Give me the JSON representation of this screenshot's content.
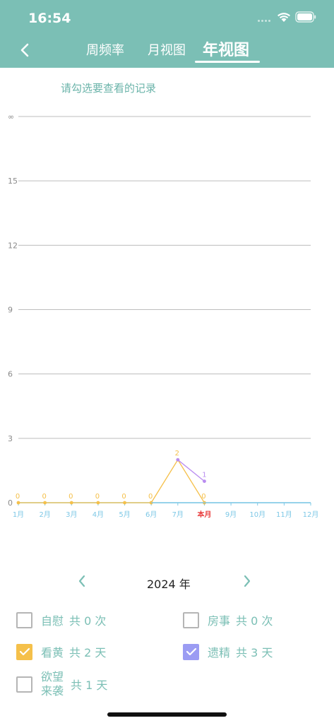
{
  "status": {
    "time": "16:54"
  },
  "tabs": [
    {
      "label": "周频率"
    },
    {
      "label": "月视图"
    },
    {
      "label": "年视图",
      "active": true
    }
  ],
  "hint": "请勾选要查看的记录",
  "chart_data": {
    "type": "line",
    "y_ticks": [
      "0",
      "3",
      "6",
      "9",
      "12",
      "15",
      "∞"
    ],
    "ylim": [
      0,
      18
    ],
    "categories": [
      "1月",
      "2月",
      "3月",
      "4月",
      "5月",
      "6月",
      "7月",
      "本月",
      "9月",
      "10月",
      "11月",
      "12月"
    ],
    "current_month_index": 7,
    "grid": true,
    "series": [
      {
        "values": [
          0,
          0,
          0,
          0,
          0,
          0,
          2,
          0
        ],
        "labels": [
          "0",
          "0",
          "0",
          "0",
          "0",
          "0",
          "2",
          "0"
        ],
        "color": "#f5c04a"
      },
      {
        "values": [
          null,
          null,
          null,
          null,
          null,
          null,
          2,
          1
        ],
        "labels": [
          null,
          null,
          null,
          null,
          null,
          null,
          null,
          "1"
        ],
        "color": "#b98cf0"
      },
      {
        "values": [
          null,
          null,
          null,
          null,
          null,
          0,
          0,
          0,
          0,
          0,
          0,
          0
        ],
        "labels": [],
        "color": "#7ec8e6"
      }
    ],
    "colors": {
      "axis": "#7ec8e6",
      "current_month": "#e83b3b",
      "grid": "#bdbdbd",
      "tick": "#8a8a8a"
    }
  },
  "year_nav": {
    "label": "2024 年"
  },
  "legend": [
    {
      "name": "自慰",
      "count": "共 0 次",
      "checked": false,
      "color": ""
    },
    {
      "name": "房事",
      "count": "共 0 次",
      "checked": false,
      "color": ""
    },
    {
      "name": "看黄",
      "count": "共 2 天",
      "checked": true,
      "color": "#f5c04a"
    },
    {
      "name": "遗精",
      "count": "共 3 天",
      "checked": true,
      "color": "#9b9cf3"
    },
    {
      "name": "欲望来袭",
      "name_lines": [
        "欲望",
        "来袭"
      ],
      "count": "共 1 天",
      "checked": false,
      "color": ""
    }
  ]
}
